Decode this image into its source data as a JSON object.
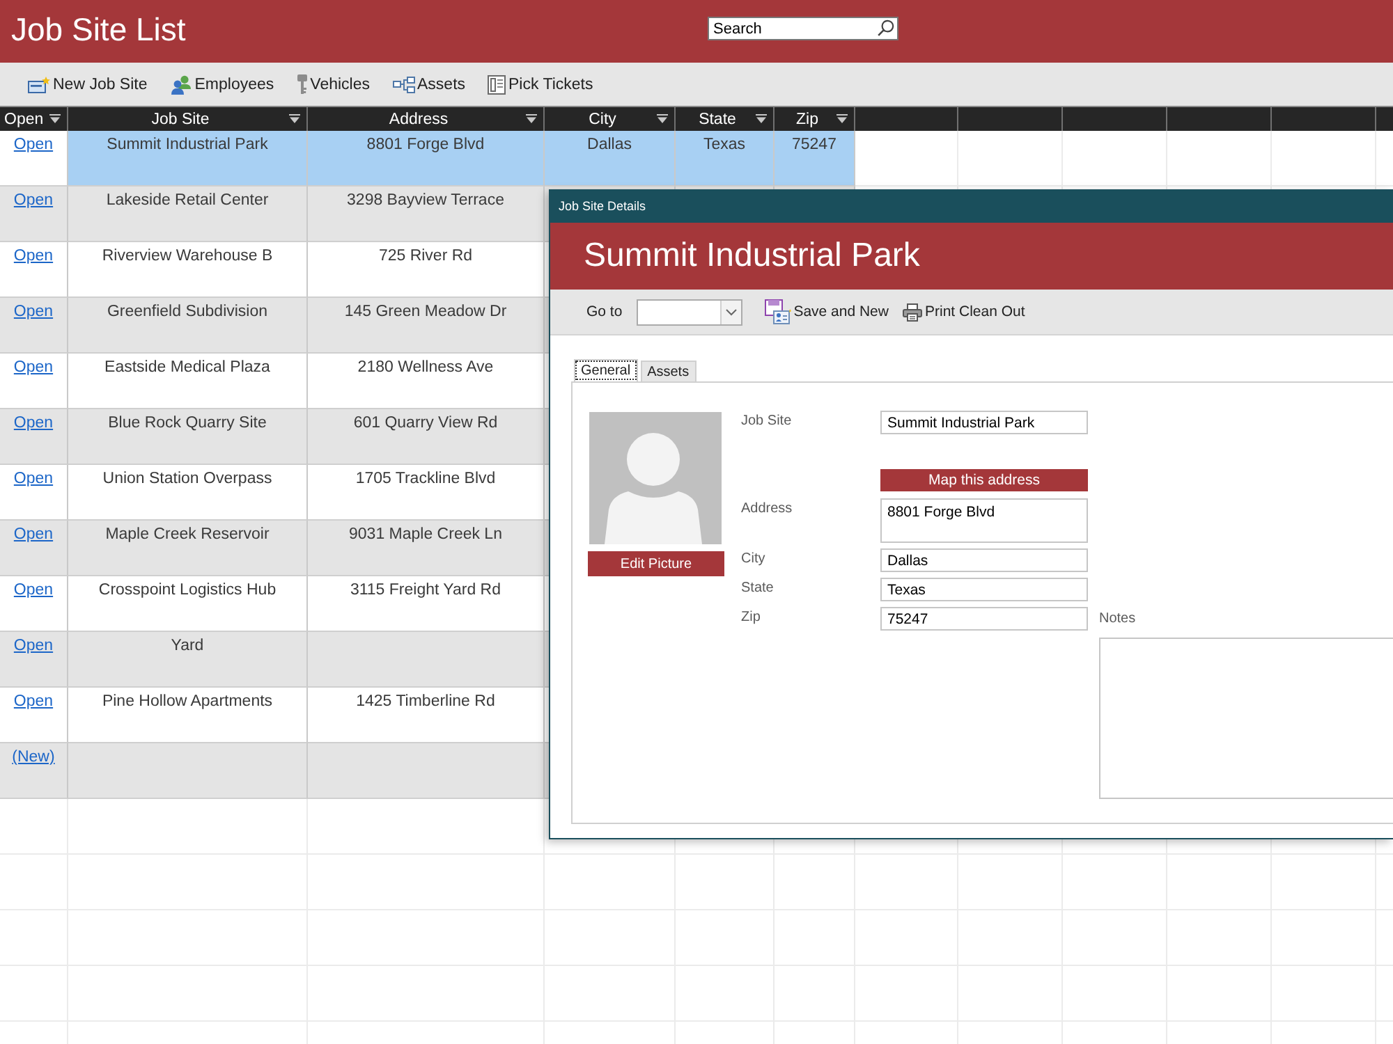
{
  "header": {
    "title": "Job Site List",
    "search": {
      "placeholder": "Search"
    }
  },
  "toolbar": [
    {
      "label": "New Job Site",
      "kind": "new"
    },
    {
      "label": "Employees",
      "kind": "people"
    },
    {
      "label": "Vehicles",
      "kind": "key"
    },
    {
      "label": "Assets",
      "kind": "network"
    },
    {
      "label": "Pick Tickets",
      "kind": "document"
    }
  ],
  "table": {
    "columns": [
      {
        "label": "Open"
      },
      {
        "label": "Job Site"
      },
      {
        "label": "Address"
      },
      {
        "label": "City"
      },
      {
        "label": "State"
      },
      {
        "label": "Zip"
      }
    ],
    "rows": [
      {
        "link": "Open",
        "job_site": "Summit Industrial Park",
        "address": "8801 Forge Blvd",
        "city": "Dallas",
        "state": "Texas",
        "zip": "75247",
        "selected": true
      },
      {
        "link": "Open",
        "job_site": "Lakeside Retail Center",
        "address": "3298 Bayview Terrace",
        "selected": false
      },
      {
        "link": "Open",
        "job_site": "Riverview Warehouse B",
        "address": "725 River Rd",
        "selected": false
      },
      {
        "link": "Open",
        "job_site": "Greenfield Subdivision",
        "address": "145 Green Meadow Dr",
        "selected": false
      },
      {
        "link": "Open",
        "job_site": "Eastside Medical Plaza",
        "address": "2180 Wellness Ave",
        "selected": false
      },
      {
        "link": "Open",
        "job_site": "Blue Rock Quarry Site",
        "address": "601 Quarry View Rd",
        "selected": false
      },
      {
        "link": "Open",
        "job_site": "Union Station Overpass",
        "address": "1705 Trackline Blvd",
        "selected": false
      },
      {
        "link": "Open",
        "job_site": "Maple Creek Reservoir",
        "address": "9031 Maple Creek Ln",
        "selected": false
      },
      {
        "link": "Open",
        "job_site": "Crosspoint Logistics Hub",
        "address": "3115 Freight Yard Rd",
        "selected": false
      },
      {
        "link": "Open",
        "job_site": "Yard",
        "selected": false
      },
      {
        "link": "Open",
        "job_site": "Pine Hollow Apartments",
        "address": "1425 Timberline Rd",
        "selected": false
      },
      {
        "link": "(New)",
        "selected": false
      }
    ]
  },
  "dialog": {
    "title": "Job Site Details",
    "heading": "Summit Industrial Park",
    "goto_label": "Go to",
    "actions": [
      {
        "label": "Save and New",
        "kind": "save"
      },
      {
        "label": "Print Clean Out",
        "kind": "print"
      }
    ],
    "tabs": [
      {
        "label": "General",
        "selected": true
      },
      {
        "label": "Assets",
        "selected": false
      }
    ],
    "picture_button": "Edit Picture",
    "form": [
      {
        "kind": "text",
        "label": "Job Site",
        "value": "Summit Industrial Park"
      },
      {
        "kind": "button",
        "label": "Map this address"
      },
      {
        "kind": "multiline",
        "label": "Address",
        "value": "8801 Forge Blvd"
      },
      {
        "kind": "text",
        "label": "City",
        "value": "Dallas"
      },
      {
        "kind": "text",
        "label": "State",
        "value": "Texas"
      },
      {
        "kind": "text",
        "label": "Zip",
        "value": "75247"
      }
    ],
    "notes": {
      "label": "Notes"
    }
  }
}
